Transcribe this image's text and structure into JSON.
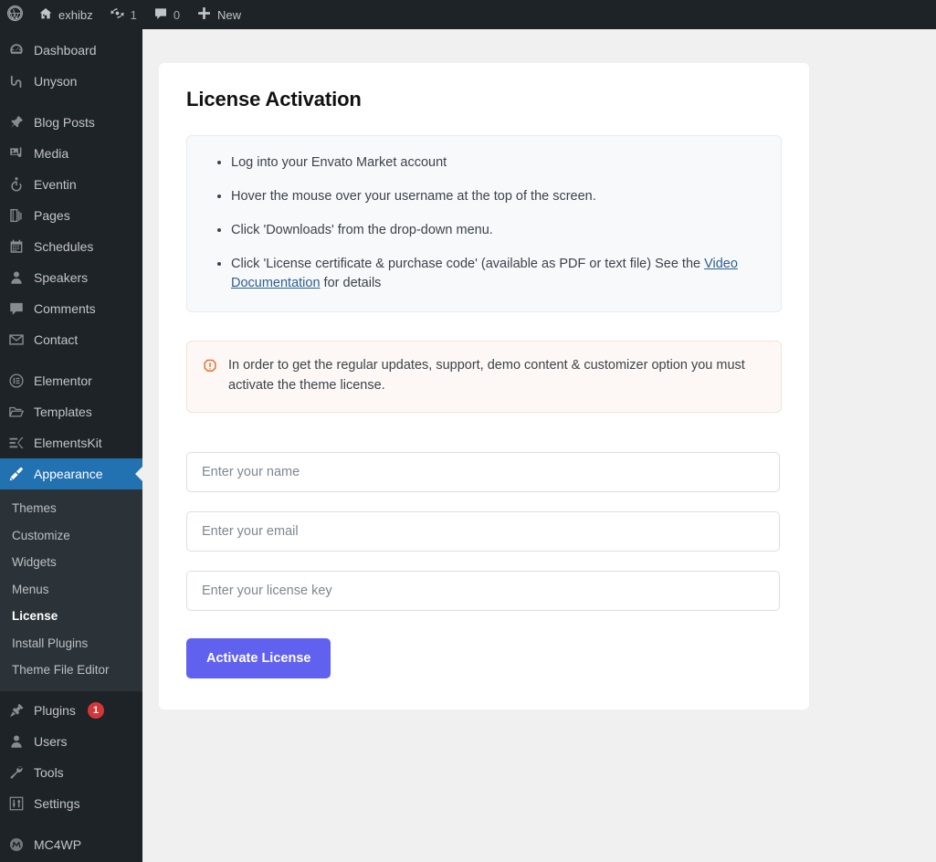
{
  "adminbar": {
    "logo_icon": "wordpress-logo-icon",
    "site_name": "exhibz",
    "site_icon": "home-icon",
    "updates_icon": "updates-icon",
    "updates_count": "1",
    "comments_icon": "comment-bubble-icon",
    "comments_count": "0",
    "new_icon": "plus-icon",
    "new_label": "New"
  },
  "sidebar": {
    "items": [
      {
        "label": "Dashboard",
        "icon": "dashboard-icon",
        "key": "dashboard"
      },
      {
        "label": "Unyson",
        "icon": "unyson-icon",
        "key": "unyson"
      },
      {
        "label": "Blog Posts",
        "icon": "pin-icon",
        "key": "blog-posts"
      },
      {
        "label": "Media",
        "icon": "media-icon",
        "key": "media"
      },
      {
        "label": "Eventin",
        "icon": "eventin-icon",
        "key": "eventin"
      },
      {
        "label": "Pages",
        "icon": "pages-icon",
        "key": "pages"
      },
      {
        "label": "Schedules",
        "icon": "calendar-icon",
        "key": "schedules"
      },
      {
        "label": "Speakers",
        "icon": "user-icon",
        "key": "speakers"
      },
      {
        "label": "Comments",
        "icon": "comment-bubble-icon",
        "key": "comments"
      },
      {
        "label": "Contact",
        "icon": "envelope-icon",
        "key": "contact"
      },
      {
        "label": "Elementor",
        "icon": "elementor-icon",
        "key": "elementor"
      },
      {
        "label": "Templates",
        "icon": "folder-icon",
        "key": "templates"
      },
      {
        "label": "ElementsKit",
        "icon": "elementskit-icon",
        "key": "elementskit"
      },
      {
        "label": "Appearance",
        "icon": "paintbrush-icon",
        "key": "appearance",
        "current": true
      },
      {
        "label": "Plugins",
        "icon": "plug-icon",
        "key": "plugins",
        "badge": "1"
      },
      {
        "label": "Users",
        "icon": "user-icon",
        "key": "users"
      },
      {
        "label": "Tools",
        "icon": "wrench-icon",
        "key": "tools"
      },
      {
        "label": "Settings",
        "icon": "sliders-icon",
        "key": "settings"
      },
      {
        "label": "MC4WP",
        "icon": "mc4wp-icon",
        "key": "mc4wp"
      }
    ],
    "appearance_submenu": [
      {
        "label": "Themes",
        "key": "themes"
      },
      {
        "label": "Customize",
        "key": "customize"
      },
      {
        "label": "Widgets",
        "key": "widgets"
      },
      {
        "label": "Menus",
        "key": "menus"
      },
      {
        "label": "License",
        "key": "license",
        "current": true
      },
      {
        "label": "Install Plugins",
        "key": "install-plugins"
      },
      {
        "label": "Theme File Editor",
        "key": "theme-file-editor"
      }
    ]
  },
  "main": {
    "title": "License Activation",
    "steps": [
      {
        "text": "Log into your Envato Market account"
      },
      {
        "text": "Hover the mouse over your username at the top of the screen."
      },
      {
        "text": "Click 'Downloads' from the drop-down menu."
      },
      {
        "text_before": "Click 'License certificate & purchase code' (available as PDF or text file) See the ",
        "link": "Video Documentation",
        "text_after": " for details"
      }
    ],
    "notice": {
      "icon": "warning-hexagon-icon",
      "text": "In order to get the regular updates, support, demo content & customizer option you must activate the theme license."
    },
    "form": {
      "name_placeholder": "Enter your name",
      "name_value": "",
      "email_placeholder": "Enter your email",
      "email_value": "",
      "license_placeholder": "Enter your license key",
      "license_value": "",
      "submit_label": "Activate License"
    }
  },
  "colors": {
    "admin_dark": "#1d2327",
    "submenu_dark": "#2c3338",
    "current_blue": "#2271b1",
    "accent_purple": "#6161f0",
    "badge_red": "#d63638",
    "notice_orange": "#f26524",
    "page_bg": "#f0f0f1"
  }
}
